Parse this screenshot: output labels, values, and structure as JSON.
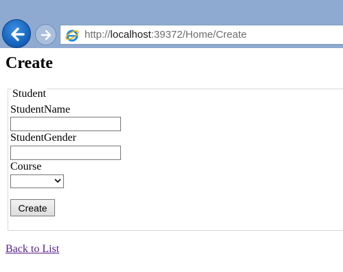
{
  "browser": {
    "url_prefix": "http://",
    "url_host": "localhost",
    "url_rest": ":39372/Home/Create"
  },
  "page": {
    "title": "Create"
  },
  "form": {
    "legend": "Student",
    "student_name_label": "StudentName",
    "student_name_value": "",
    "student_gender_label": "StudentGender",
    "student_gender_value": "",
    "course_label": "Course",
    "course_selected": "",
    "submit_label": "Create"
  },
  "footer": {
    "back_link": "Back to List"
  }
}
